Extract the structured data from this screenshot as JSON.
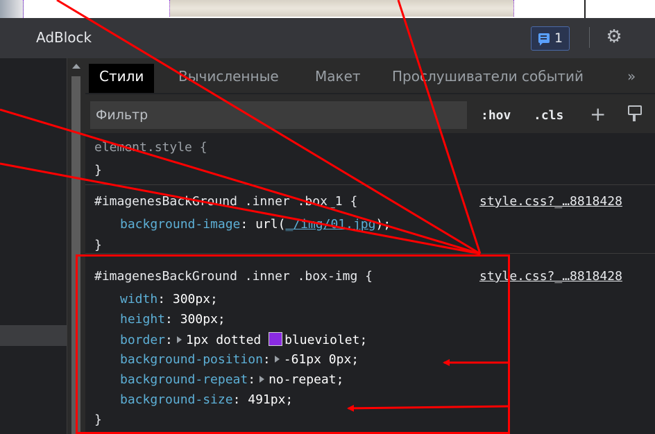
{
  "devtools": {
    "title": "AdBlock",
    "issues_count": "1",
    "tabs": [
      "Стили",
      "Вычисленные",
      "Макет",
      "Прослушиватели событий",
      "»"
    ],
    "filter_placeholder": "Фильтр",
    "hov_label": ":hov",
    "cls_label": ".cls",
    "plus_label": "+"
  },
  "styles": {
    "element_style": {
      "selector": "element.style {",
      "close": "}"
    },
    "rule1": {
      "selector": "#imagenesBackGround .inner .box_1 {",
      "source": "style.css?_…8818428",
      "prop": "background-image",
      "val_prefix": "url(",
      "url": "_/img/01.jpg",
      "val_suffix": ");",
      "close": "}"
    },
    "rule2": {
      "selector": "#imagenesBackGround .inner .box-img {",
      "source": "style.css?_…8818428",
      "declarations": [
        {
          "prop": "width",
          "value": "300px;"
        },
        {
          "prop": "height",
          "value": "300px;"
        },
        {
          "prop": "border",
          "value_pre": "1px dotted ",
          "value_color": "blueviolet;"
        },
        {
          "prop": "background-position",
          "value": "-61px 0px;"
        },
        {
          "prop": "background-repeat",
          "value": "no-repeat;"
        },
        {
          "prop": "background-size",
          "value": "491px;"
        }
      ],
      "close": "}"
    }
  },
  "colors": {
    "annotation": "#ff0000",
    "swatch": "#8a2be2",
    "property": "#5db0d7"
  },
  "icons": [
    "issues-icon",
    "gear-icon",
    "color-palette-icon",
    "scroll-up-icon",
    "expand-triangle-icon"
  ]
}
